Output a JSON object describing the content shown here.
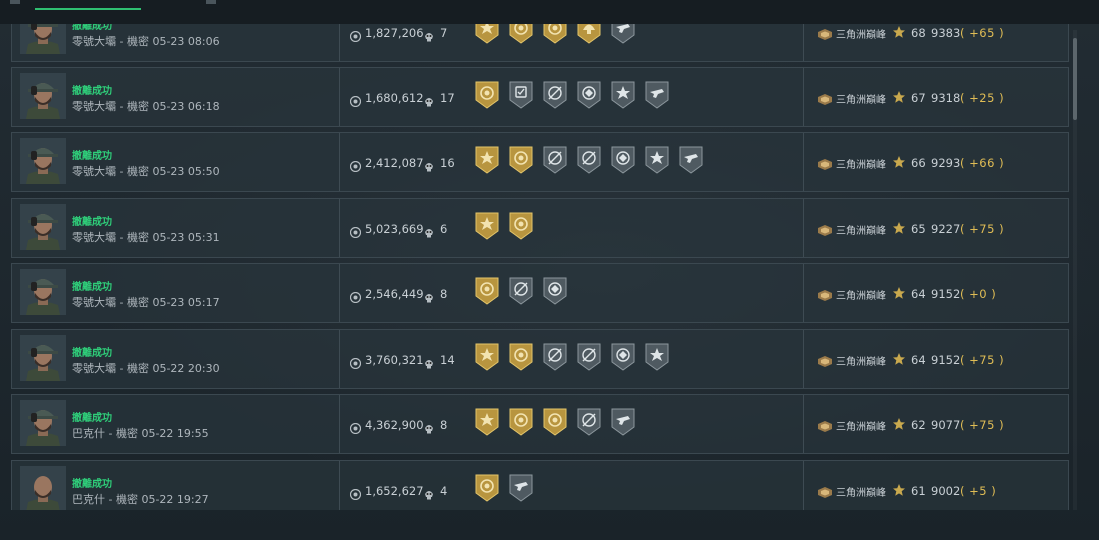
{
  "top_tabs": [
    "",
    ""
  ],
  "rows": [
    {
      "status": "撤離成功",
      "sub": "零號大壩 - 機密 05-23 08:06",
      "value": "1,827,206",
      "kills": "7",
      "badges": [
        "gold-star",
        "gold-ring",
        "gold-ring",
        "gold-helmet",
        "gray-gun"
      ],
      "mode": "三角洲巔峰",
      "level": "68",
      "score": "9383",
      "delta": "( +65 )"
    },
    {
      "status": "撤離成功",
      "sub": "零號大壩 - 機密 05-23 06:18",
      "value": "1,680,612",
      "kills": "17",
      "badges": [
        "gold-ring",
        "gray-shield",
        "gray-target",
        "gray-eye",
        "gray-star",
        "gray-gun"
      ],
      "mode": "三角洲巔峰",
      "level": "67",
      "score": "9318",
      "delta": "( +25 )"
    },
    {
      "status": "撤離成功",
      "sub": "零號大壩 - 機密 05-23 05:50",
      "value": "2,412,087",
      "kills": "16",
      "badges": [
        "gold-star",
        "gold-ring",
        "gray-target",
        "gray-target",
        "gray-eye",
        "gray-star",
        "gray-gun"
      ],
      "mode": "三角洲巔峰",
      "level": "66",
      "score": "9293",
      "delta": "( +66 )"
    },
    {
      "status": "撤離成功",
      "sub": "零號大壩 - 機密 05-23 05:31",
      "value": "5,023,669",
      "kills": "6",
      "badges": [
        "gold-star",
        "gold-ring"
      ],
      "mode": "三角洲巔峰",
      "level": "65",
      "score": "9227",
      "delta": "( +75 )"
    },
    {
      "status": "撤離成功",
      "sub": "零號大壩 - 機密 05-23 05:17",
      "value": "2,546,449",
      "kills": "8",
      "badges": [
        "gold-ring",
        "gray-target",
        "gray-eye"
      ],
      "mode": "三角洲巔峰",
      "level": "64",
      "score": "9152",
      "delta": "( +0 )"
    },
    {
      "status": "撤離成功",
      "sub": "零號大壩 - 機密 05-22 20:30",
      "value": "3,760,321",
      "kills": "14",
      "badges": [
        "gold-star",
        "gold-ring",
        "gray-target",
        "gray-target",
        "gray-eye",
        "gray-star"
      ],
      "mode": "三角洲巔峰",
      "level": "64",
      "score": "9152",
      "delta": "( +75 )"
    },
    {
      "status": "撤離成功",
      "sub": "巴克什 - 機密 05-22 19:55",
      "value": "4,362,900",
      "kills": "8",
      "badges": [
        "gold-star",
        "gold-ring",
        "gold-ring",
        "gray-target",
        "gray-gun"
      ],
      "mode": "三角洲巔峰",
      "level": "62",
      "score": "9077",
      "delta": "( +75 )"
    },
    {
      "status": "撤離成功",
      "sub": "巴克什 - 機密 05-22 19:27",
      "value": "1,652,627",
      "kills": "4",
      "badges": [
        "gold-ring",
        "gray-gun"
      ],
      "mode": "三角洲巔峰",
      "level": "61",
      "score": "9002",
      "delta": "( +5 )"
    }
  ],
  "colors": {
    "success": "#2fcf7a",
    "gold": "#c9a64a",
    "gray_badge": "#5a656c",
    "delta": "#e0bd55"
  }
}
